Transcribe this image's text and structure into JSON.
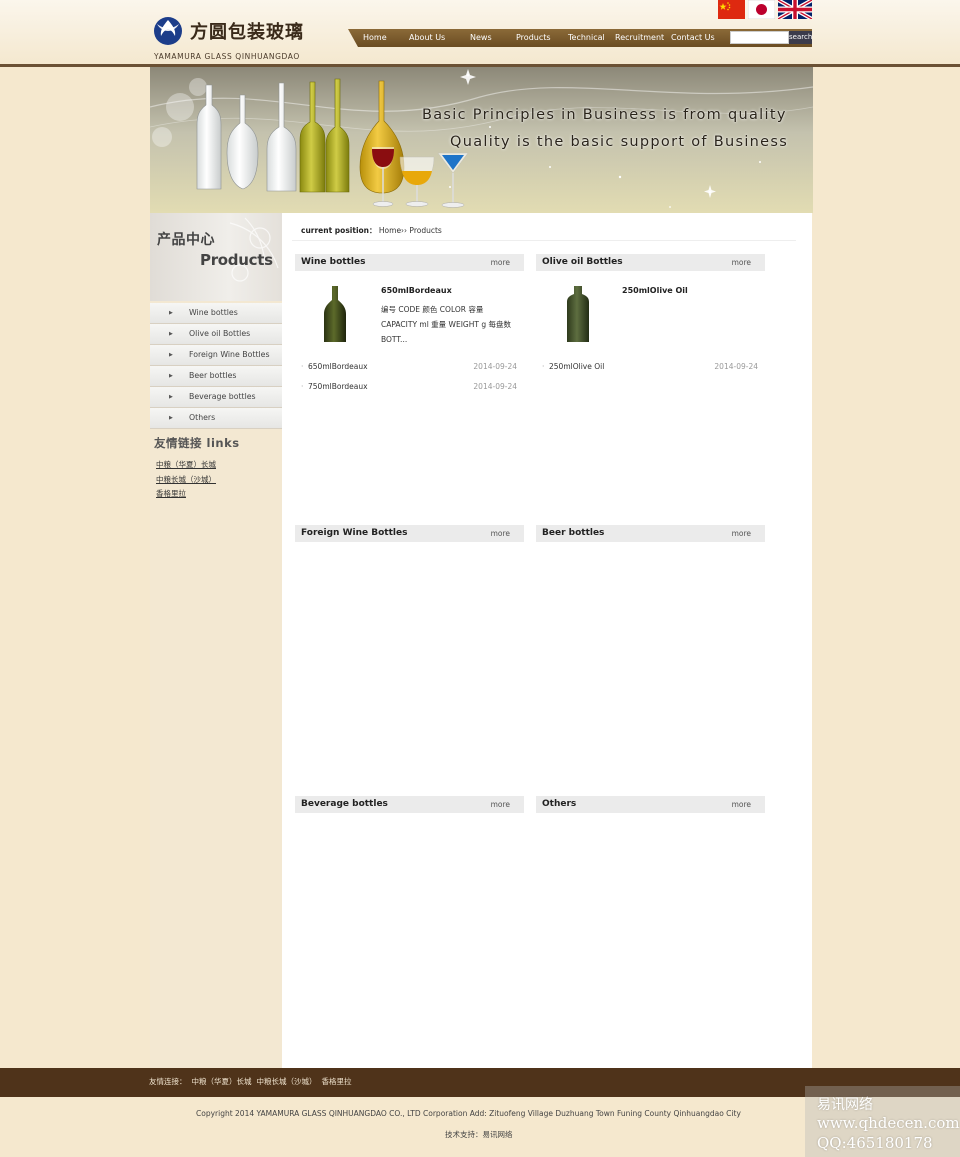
{
  "header": {
    "logo_cn": "方圆包装玻璃",
    "logo_en": "YAMAMURA GLASS QINHUANGDAO",
    "flags": [
      "china-flag-icon",
      "japan-flag-icon",
      "uk-flag-icon"
    ],
    "nav": [
      "Home",
      "About Us",
      "News",
      "Products",
      "Technical",
      "Recruitment",
      "Contact Us"
    ],
    "search_value": "",
    "search_label": "search"
  },
  "banner": {
    "line1": "Basic Principles in Business is from quality",
    "line2": "Quality is the basic support of Business"
  },
  "sidebar": {
    "title_cn": "产品中心",
    "title_en": "Products",
    "items": [
      "Wine bottles",
      "Olive oil Bottles",
      "Foreign Wine Bottles",
      "Beer bottles",
      "Beverage bottles",
      "Others"
    ],
    "links_title": "友情链接  links",
    "links": [
      "中粮（华夏）长城",
      "中粮长城（沙城）",
      "香格里拉"
    ]
  },
  "breadcrumb": {
    "label": "current position：",
    "path": "Home›› Products"
  },
  "sections": [
    {
      "title": "Wine bottles",
      "more": "more",
      "featured": {
        "name": "650mlBordeaux",
        "desc": "编号 CODE 颜色 COLOR 容量 CAPACITY ml 重量 WEIGHT g 每盘数 BOTT..."
      },
      "items": [
        {
          "name": "650mlBordeaux",
          "date": "2014-09-24"
        },
        {
          "name": "750mlBordeaux",
          "date": "2014-09-24"
        }
      ]
    },
    {
      "title": "Olive oil Bottles",
      "more": "more",
      "featured": {
        "name": "250mlOlive Oil",
        "desc": ""
      },
      "items": [
        {
          "name": "250mlOlive Oil",
          "date": "2014-09-24"
        }
      ]
    },
    {
      "title": "Foreign Wine Bottles",
      "more": "more"
    },
    {
      "title": "Beer bottles",
      "more": "more"
    },
    {
      "title": "Beverage bottles",
      "more": "more"
    },
    {
      "title": "Others",
      "more": "more"
    }
  ],
  "footer": {
    "links_label": "友情连接：",
    "links": [
      "中粮（华夏）长城",
      "中粮长城（沙城）",
      "香格里拉"
    ],
    "copyright": "Copyright 2014 YAMAMURA GLASS QINHUANGDAO CO., LTD Corporation Add: Zituofeng Village Duzhuang Town Funing County Qinhuangdao City",
    "support": "技术支持：易讯网络"
  },
  "watermark": {
    "line1": "易讯网络",
    "line2": "www.qhdecen.com",
    "line3": "QQ:465180178"
  },
  "colors": {
    "page_bg": "#f5e8ce",
    "nav_bg": "#7a5a2c",
    "footer_bg": "#4f331a",
    "section_bar": "#ebebeb"
  }
}
